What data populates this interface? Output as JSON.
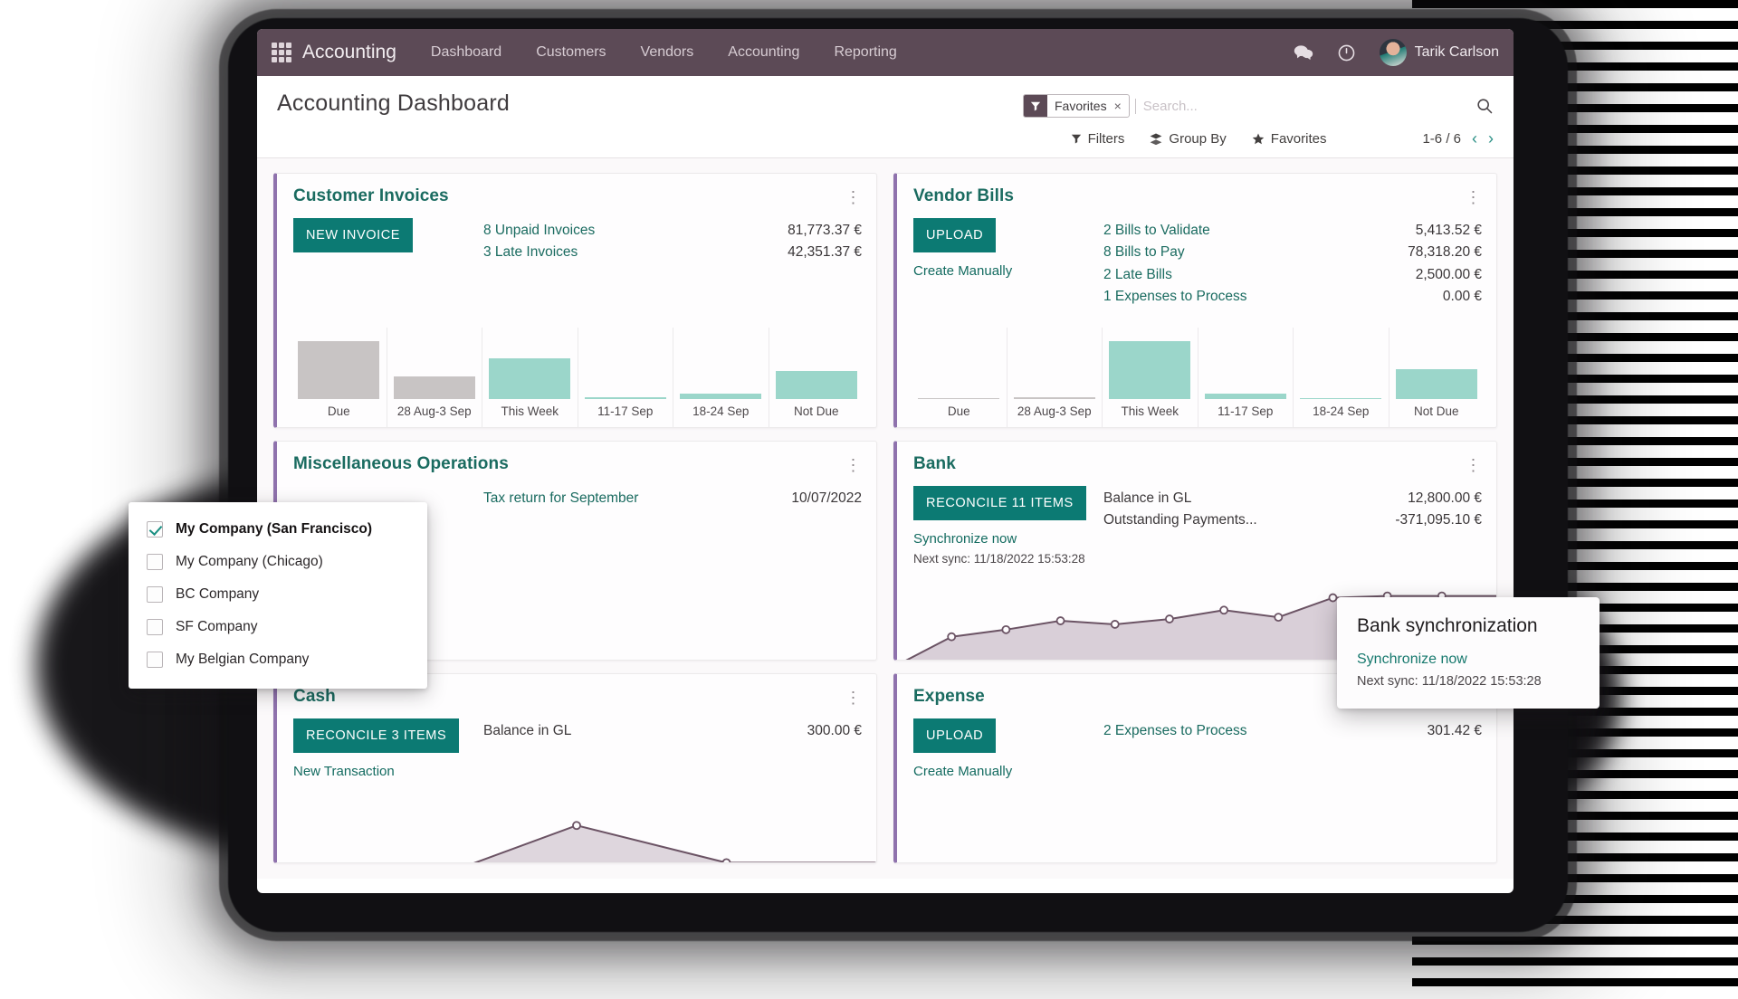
{
  "navbar": {
    "apps_icon": "grid-apps-icon",
    "brand": "Accounting",
    "links": [
      "Dashboard",
      "Customers",
      "Vendors",
      "Accounting",
      "Reporting"
    ],
    "messages_icon": "chat-bubble-icon",
    "activity_icon": "clock-icon",
    "user_name": "Tarik Carlson",
    "bg_color": "#5c4a56"
  },
  "control_panel": {
    "page_title": "Accounting Dashboard",
    "facet_label": "Favorites",
    "facet_remove": "×",
    "search_placeholder": "Search...",
    "search_value": "",
    "filters_label": "Filters",
    "group_by_label": "Group By",
    "favorites_label": "Favorites",
    "pager_text": "1-6 / 6",
    "prev_arrow": "‹",
    "next_arrow": "›"
  },
  "cards": {
    "customer_invoices": {
      "title": "Customer Invoices",
      "button": "NEW INVOICE",
      "stats": [
        {
          "label": "8 Unpaid Invoices",
          "value": "81,773.37 €"
        },
        {
          "label": "3 Late Invoices",
          "value": "42,351.37 €"
        }
      ]
    },
    "vendor_bills": {
      "title": "Vendor Bills",
      "button": "UPLOAD",
      "link": "Create Manually",
      "stats": [
        {
          "label": "2 Bills to Validate",
          "value": "5,413.52 €"
        },
        {
          "label": "8 Bills to Pay",
          "value": "78,318.20 €"
        },
        {
          "label": "2 Late Bills",
          "value": "2,500.00 €"
        },
        {
          "label": "1 Expenses to Process",
          "value": "0.00 €"
        }
      ]
    },
    "misc_operations": {
      "title": "Miscellaneous Operations",
      "stats": [
        {
          "label": "Tax return for September",
          "value": "10/07/2022"
        }
      ]
    },
    "bank": {
      "title": "Bank",
      "button": "RECONCILE 11 ITEMS",
      "link": "Synchronize now",
      "note": "Next sync: 11/18/2022 15:53:28",
      "stats": [
        {
          "label": "Balance in GL",
          "value": "12,800.00 €"
        },
        {
          "label": "Outstanding Payments...",
          "value": "-371,095.10 €"
        }
      ]
    },
    "cash": {
      "title": "Cash",
      "button": "RECONCILE 3 ITEMS",
      "link": "New Transaction",
      "stats": [
        {
          "label": "Balance in GL",
          "value": "300.00 €"
        }
      ]
    },
    "expense": {
      "title": "Expense",
      "button": "UPLOAD",
      "link": "Create Manually",
      "stats": [
        {
          "label": "2 Expenses to Process",
          "value": "301.42 €"
        }
      ]
    }
  },
  "company_dropdown": {
    "items": [
      {
        "label": "My Company (San Francisco)",
        "checked": true
      },
      {
        "label": "My Company (Chicago)",
        "checked": false
      },
      {
        "label": "BC Company",
        "checked": false
      },
      {
        "label": "SF Company",
        "checked": false
      },
      {
        "label": "My Belgian Company",
        "checked": false
      }
    ]
  },
  "tooltip": {
    "title": "Bank synchronization",
    "link": "Synchronize now",
    "note": "Next sync: 11/18/2022 15:53:28"
  },
  "chart_data": [
    {
      "type": "bar",
      "id": "customer-invoices-aging",
      "title": "Customer Invoices aging",
      "categories": [
        "Due",
        "28 Aug-3 Sep",
        "This Week",
        "11-17 Sep",
        "18-24 Sep",
        "Not Due"
      ],
      "values": [
        62,
        24,
        44,
        2,
        6,
        30
      ],
      "colors": [
        "#c8c4c4",
        "#c8c4c4",
        "#9bd6ca",
        "#9bd6ca",
        "#9bd6ca",
        "#9bd6ca"
      ],
      "ylim": [
        0,
        70
      ],
      "xlabel": "",
      "ylabel": ""
    },
    {
      "type": "bar",
      "id": "vendor-bills-aging",
      "title": "Vendor Bills aging",
      "categories": [
        "Due",
        "28 Aug-3 Sep",
        "This Week",
        "11-17 Sep",
        "18-24 Sep",
        "Not Due"
      ],
      "values": [
        0,
        2,
        62,
        6,
        0,
        32
      ],
      "colors": [
        "#c8c4c4",
        "#c8c4c4",
        "#9bd6ca",
        "#9bd6ca",
        "#9bd6ca",
        "#9bd6ca"
      ],
      "ylim": [
        0,
        70
      ],
      "xlabel": "",
      "ylabel": ""
    },
    {
      "type": "area",
      "id": "bank-balance-trend",
      "title": "Bank balance trend",
      "x": [
        0,
        1,
        2,
        3,
        4,
        5,
        6,
        7,
        8,
        9,
        10,
        11
      ],
      "values": [
        2,
        34,
        42,
        52,
        48,
        54,
        64,
        56,
        78,
        80,
        80,
        80
      ],
      "line_color": "#6b5364",
      "fill_color": "#d9cfd8",
      "ylim": [
        0,
        100
      ]
    },
    {
      "type": "area",
      "id": "cash-balance-trend",
      "title": "Cash balance trend",
      "x": [
        0,
        1,
        2,
        3,
        4
      ],
      "values": [
        0,
        0,
        62,
        20,
        20
      ],
      "line_color": "#6b5364",
      "fill_color": "#ded6dd",
      "ylim": [
        0,
        100
      ]
    }
  ]
}
